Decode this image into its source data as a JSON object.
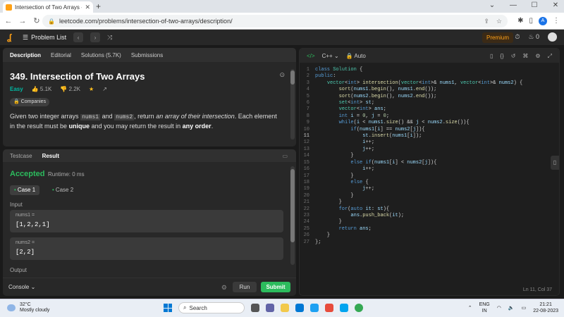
{
  "browser": {
    "tab_title": "Intersection of Two Arrays - LeetCode",
    "tab_title_display": "Intersection of Two Arrays - Leet",
    "url": "leetcode.com/problems/intersection-of-two-arrays/description/",
    "profile_initial": "A"
  },
  "header": {
    "problem_list": "Problem List",
    "premium": "Premium",
    "streak_count": "0"
  },
  "left_tabs": [
    "Description",
    "Editorial",
    "Solutions (5.7K)",
    "Submissions"
  ],
  "problem": {
    "title": "349. Intersection of Two Arrays",
    "difficulty": "Easy",
    "likes": "5.1K",
    "dislikes": "2.2K",
    "companies": "Companies",
    "desc_intro": "Given two integer arrays",
    "arr1": "nums1",
    "and": "and",
    "arr2": "nums2",
    "desc_return": ", return",
    "desc_italic": "an array of their intersection",
    "desc_rest": ". Each element in the result must be",
    "bold_unique": "unique",
    "desc_mid": "and you may return the result in",
    "bold_order": "any order",
    "period": "."
  },
  "bottom": {
    "tabs": [
      "Testcase",
      "Result"
    ],
    "status": "Accepted",
    "runtime": "Runtime: 0 ms",
    "case1": "Case 1",
    "case2": "Case 2",
    "input_label": "Input",
    "nums1_label": "nums1 =",
    "nums1_value": "[1,2,2,1]",
    "nums2_label": "nums2 =",
    "nums2_value": "[2,2]",
    "output_label": "Output",
    "console": "Console",
    "run": "Run",
    "submit": "Submit"
  },
  "editor": {
    "language": "C++",
    "mode": "Auto",
    "cursor_status": "Ln 11, Col 37",
    "current_line": 11
  },
  "taskbar": {
    "temp": "32°C",
    "weather": "Mostly cloudy",
    "search": "Search",
    "lang1": "ENG",
    "lang2": "IN",
    "time": "21:21",
    "date": "22-08-2023"
  }
}
